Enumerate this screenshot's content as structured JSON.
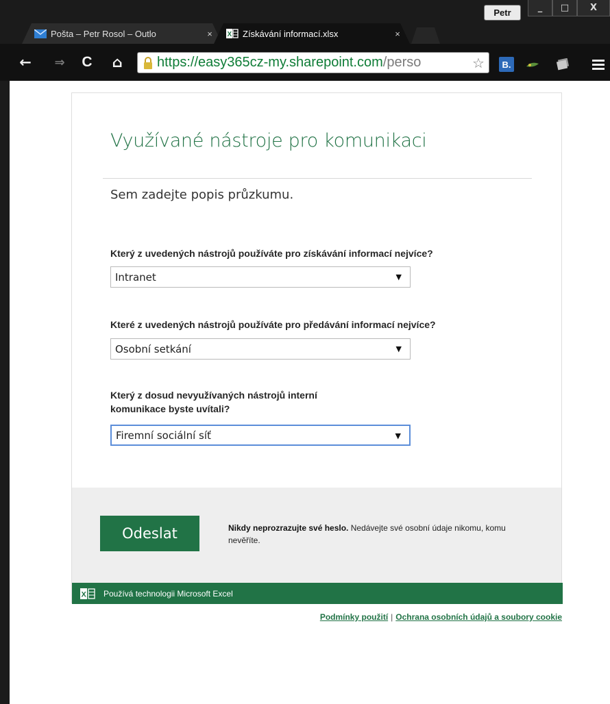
{
  "window": {
    "user": "Petr",
    "min": "_",
    "max": "□",
    "close": "X"
  },
  "tabs": [
    {
      "title": "Pošta – Petr Rosol – Outlo",
      "close": "×"
    },
    {
      "title": "Získávání informací.xlsx",
      "close": "×"
    }
  ],
  "toolbar": {
    "back": "←",
    "forward": "⇒",
    "reload": "C",
    "home": "⌂",
    "url_host": "https://easy365cz-my.sharepoint.com",
    "url_path": "/perso",
    "star": "☆",
    "ext_b": "B."
  },
  "survey": {
    "title": "Využívané nástroje pro komunikaci",
    "description": "Sem zadejte popis průzkumu.",
    "questions": [
      {
        "label": "Který z uvedených nástrojů používáte pro získávání informací nejvíce?",
        "selected": "Intranet"
      },
      {
        "label": "Které z uvedených nástrojů používáte pro předávání informací nejvíce?",
        "selected": "Osobní setkání"
      },
      {
        "label_line1": "Který z dosud nevyužívaných nástrojů interní",
        "label_line2": "komunikace byste uvítali?",
        "selected": "Firemní sociální síť"
      }
    ],
    "arrow": "▼",
    "submit": "Odeslat",
    "privacy_bold": "Nikdy neprozrazujte své heslo.",
    "privacy_rest": " Nedávejte své osobní údaje nikomu, komu nevěříte.",
    "powered_by": "Používá technologii Microsoft Excel"
  },
  "footer": {
    "terms": "Podmínky použití",
    "separator": "|",
    "privacy": "Ochrana osobních údajů a soubory cookie"
  },
  "colors": {
    "excel_green": "#217346",
    "title_green": "#207245",
    "url_green": "#0e7c36"
  }
}
